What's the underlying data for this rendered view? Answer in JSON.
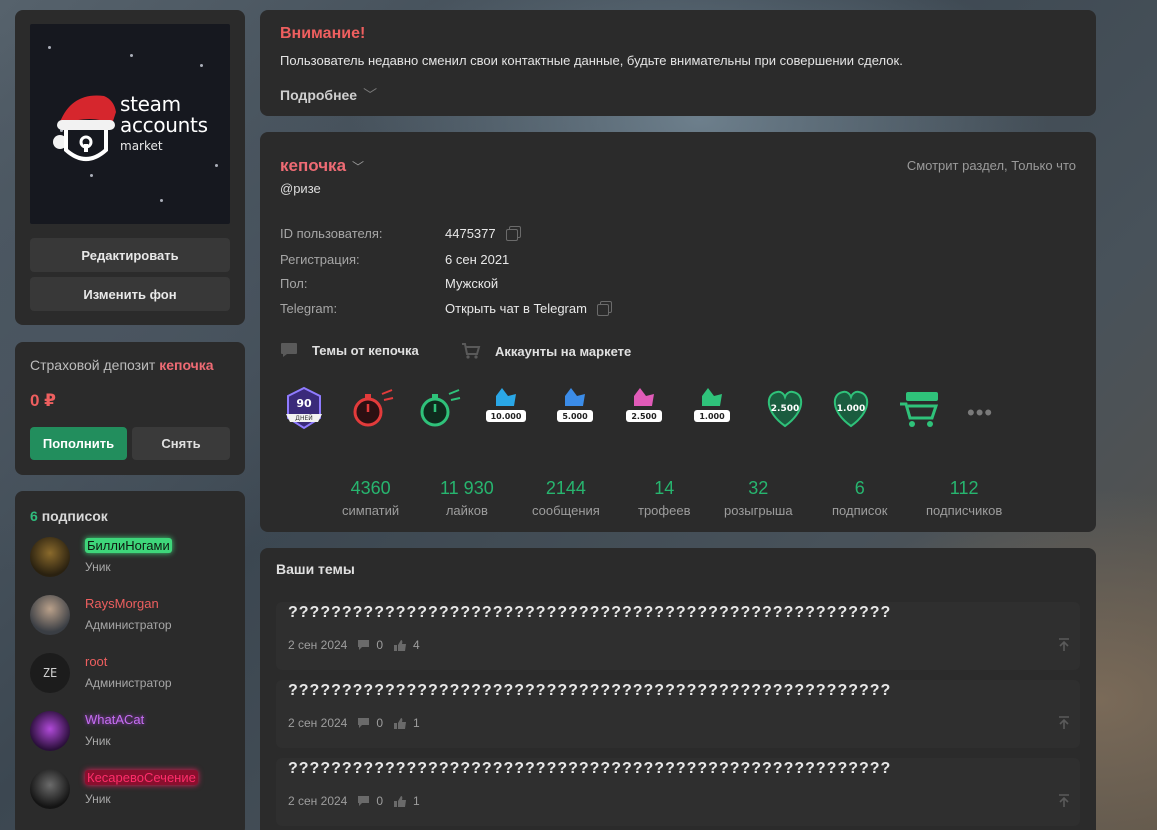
{
  "logo": {
    "line1": "steam",
    "line2": "accounts",
    "line3": "market"
  },
  "avatar_buttons": {
    "edit": "Редактировать",
    "change_bg": "Изменить фон"
  },
  "deposit": {
    "title": "Страховой депозит",
    "name": "кепочка",
    "amount": "0 ₽",
    "topup": "Пополнить",
    "withdraw": "Снять"
  },
  "subscriptions": {
    "count": "6",
    "title": "подписок",
    "items": [
      {
        "name": "БиллиНогами",
        "role": "Уник",
        "color": "#9dffb5"
      },
      {
        "name": "RaysMorgan",
        "role": "Администратор",
        "color": "#ee5f5f"
      },
      {
        "name": "root",
        "role": "Администратор",
        "color": "#ee5f5f"
      },
      {
        "name": "WhatACat",
        "role": "Уник",
        "color": "#c56df0"
      },
      {
        "name": "КесаревоСечение",
        "role": "Уник",
        "color": "#e0245e"
      }
    ]
  },
  "alert": {
    "title": "Внимание!",
    "text": "Пользователь недавно сменил свои контактные данные, будьте внимательны при совершении сделок.",
    "more": "Подробнее"
  },
  "profile": {
    "name": "кепочка",
    "handle": "@ризе",
    "status": "Смотрит раздел, Только что",
    "fields": [
      {
        "label": "ID пользователя:",
        "value": "4475377"
      },
      {
        "label": "Регистрация:",
        "value": "6 сен 2021"
      },
      {
        "label": "Пол:",
        "value": "Мужской"
      },
      {
        "label": "Telegram:",
        "value": "Открыть чат в Telegram"
      }
    ],
    "links": {
      "themes": "Темы от кепочка",
      "market": "Аккаунты на маркете"
    },
    "badges": [
      {
        "icon": "active-90-days-badge-icon",
        "text": "90 ДНЕЙ"
      },
      {
        "icon": "active-red-stopwatch-badge-icon",
        "text": "Активный"
      },
      {
        "icon": "active-green-stopwatch-badge-icon",
        "text": "Активный"
      },
      {
        "icon": "likes-10000-badge-icon",
        "text": "10.000"
      },
      {
        "icon": "likes-5000-badge-icon",
        "text": "5.000"
      },
      {
        "icon": "likes-2500-badge-icon",
        "text": "2.500"
      },
      {
        "icon": "likes-1000-badge-icon",
        "text": "1.000"
      },
      {
        "icon": "sympathies-2500-badge-icon",
        "text": "2.500"
      },
      {
        "icon": "sympathies-1000-badge-icon",
        "text": "1.000"
      },
      {
        "icon": "market-cart-badge-icon",
        "text": ""
      }
    ],
    "more_badges": "•••",
    "stats": [
      {
        "value": "4360",
        "label": "симпатий"
      },
      {
        "value": "11 930",
        "label": "лайков"
      },
      {
        "value": "2144",
        "label": "сообщения"
      },
      {
        "value": "14",
        "label": "трофеев"
      },
      {
        "value": "32",
        "label": "розыгрыша"
      },
      {
        "value": "6",
        "label": "подписок"
      },
      {
        "value": "112",
        "label": "подписчиков"
      }
    ]
  },
  "themes": {
    "title": "Ваши темы",
    "items": [
      {
        "title": "????????????????????????????????????????????????????????",
        "date": "2 сен 2024",
        "comments": "0",
        "likes": "4"
      },
      {
        "title": "????????????????????????????????????????????????????????",
        "date": "2 сен 2024",
        "comments": "0",
        "likes": "1"
      },
      {
        "title": "????????????????????????????????????????????????????????",
        "date": "2 сен 2024",
        "comments": "0",
        "likes": "1"
      }
    ]
  }
}
